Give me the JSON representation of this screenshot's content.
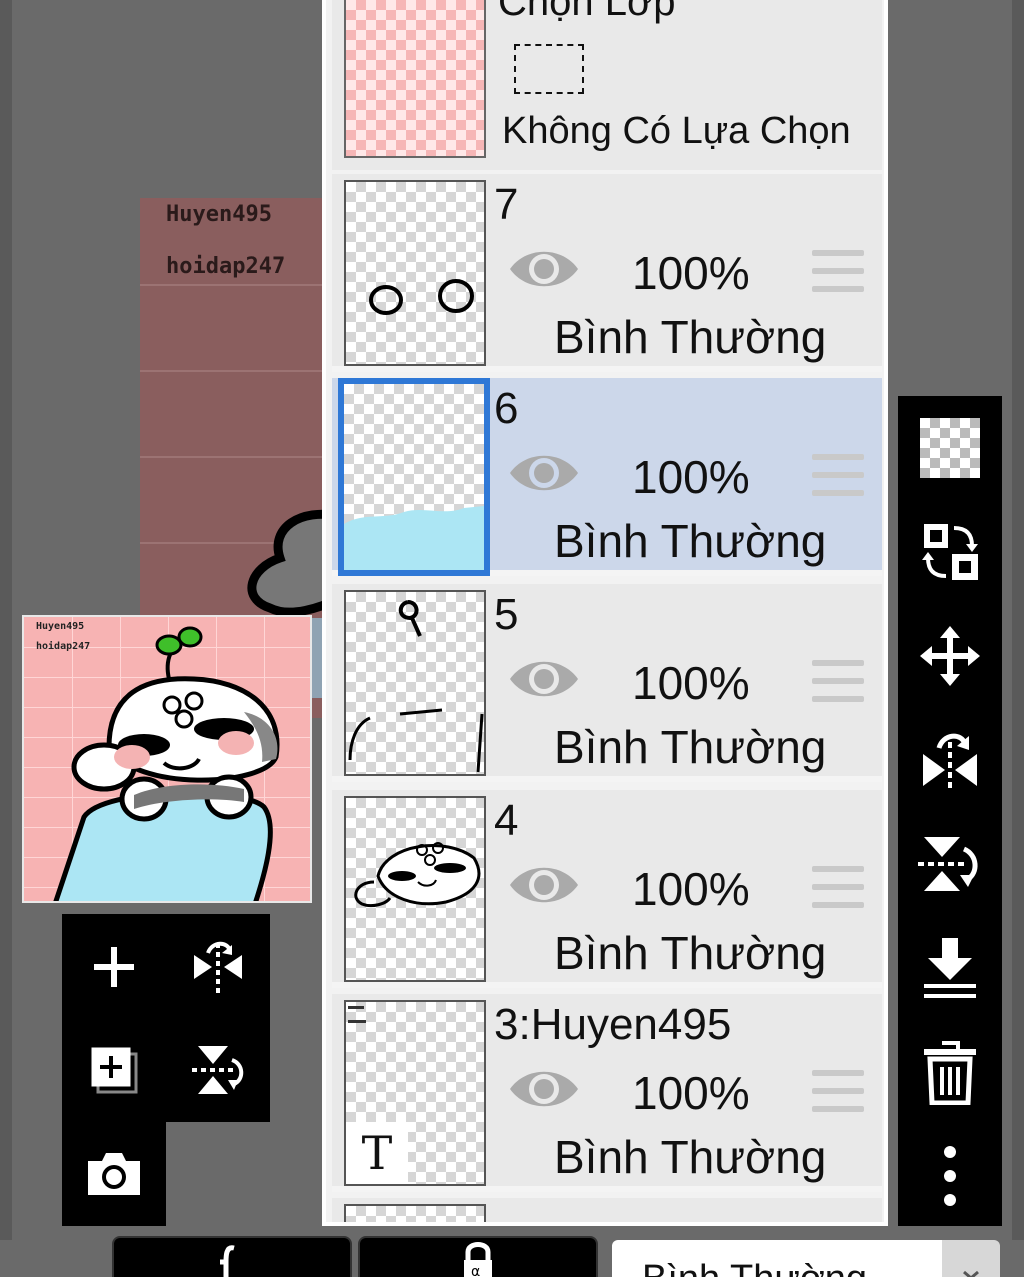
{
  "canvas": {
    "watermark_line1": "Huyen495",
    "watermark_line2": "hoidap247"
  },
  "preview": {
    "watermark_line1": "Huyen495",
    "watermark_line2": "hoidap247"
  },
  "selection_layer": {
    "title": "Chọn Lớp",
    "subtitle": "Không Có Lựa Chọn"
  },
  "layers": [
    {
      "name": "7",
      "opacity": "100%",
      "blend": "Bình Thường",
      "selected": false
    },
    {
      "name": "6",
      "opacity": "100%",
      "blend": "Bình Thường",
      "selected": true
    },
    {
      "name": "5",
      "opacity": "100%",
      "blend": "Bình Thường",
      "selected": false
    },
    {
      "name": "4",
      "opacity": "100%",
      "blend": "Bình Thường",
      "selected": false
    },
    {
      "name": "3:Huyen495",
      "opacity": "100%",
      "blend": "Bình Thường",
      "selected": false
    }
  ],
  "text_layer_glyph": "T",
  "bottom": {
    "blend_mode": "Bình Thường"
  },
  "colors": {
    "selected_layer_bg": "#ccd7ea",
    "selected_border": "#2f78d6",
    "toolbar_bg": "#000000"
  },
  "icons": {
    "left_pad": [
      "plus-icon",
      "flip-horizontal-icon",
      "add-layer-icon",
      "flip-vertical-icon",
      "camera-icon"
    ],
    "right_toolbar": [
      "transparency-icon",
      "swap-icon",
      "move-icon",
      "flip-horizontal-icon",
      "flip-vertical-icon",
      "merge-down-icon",
      "trash-icon",
      "more-icon"
    ]
  }
}
